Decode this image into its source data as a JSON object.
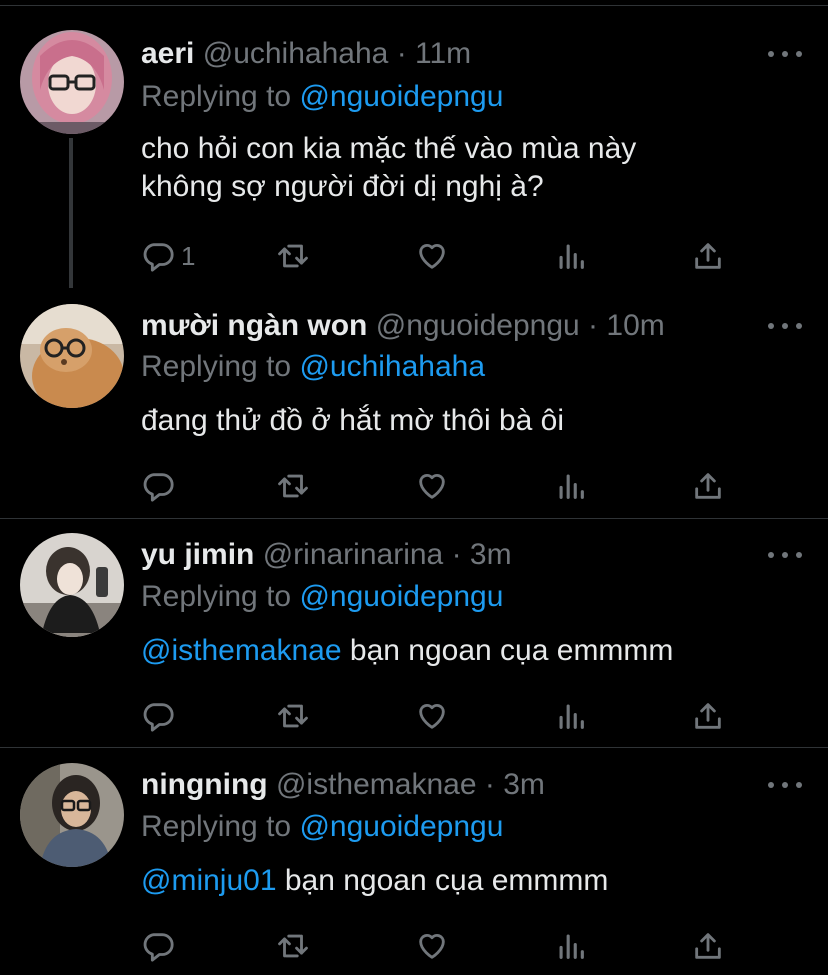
{
  "tweets": [
    {
      "name": "aeri",
      "handle": "@uchihahaha",
      "time": "11m",
      "replying_prefix": "Replying to",
      "replying_to": "@nguoidepngu",
      "text_lines": [
        "cho hỏi con kia mặc thế vào mùa này",
        "không sợ người đời dị nghị à?"
      ],
      "mention": "",
      "reply_count": "1"
    },
    {
      "name": "mười ngàn won",
      "handle": "@nguoidepngu",
      "time": "10m",
      "replying_prefix": "Replying to",
      "replying_to": "@uchihahaha",
      "text_lines": [
        "đang thử đồ ở hắt mờ thôi bà ôi"
      ],
      "mention": "",
      "reply_count": ""
    },
    {
      "name": "yu jimin",
      "handle": "@rinarinarina",
      "time": "3m",
      "replying_prefix": "Replying to",
      "replying_to": "@nguoidepngu",
      "text_lines": [
        "bạn ngoan cụa emmmm"
      ],
      "mention": "@isthemaknae",
      "reply_count": ""
    },
    {
      "name": "ningning",
      "handle": "@isthemaknae",
      "time": "3m",
      "replying_prefix": "Replying to",
      "replying_to": "@nguoidepngu",
      "text_lines": [
        "bạn ngoan cụa emmmm"
      ],
      "mention": "@minju01",
      "reply_count": ""
    }
  ],
  "separator": "·",
  "icons": [
    "reply-icon",
    "retweet-icon",
    "like-icon",
    "analytics-icon",
    "share-icon",
    "more-icon"
  ],
  "colors": {
    "background": "#000000",
    "link": "#1d9bf0",
    "muted": "#71767b",
    "text": "#e7e9ea"
  }
}
